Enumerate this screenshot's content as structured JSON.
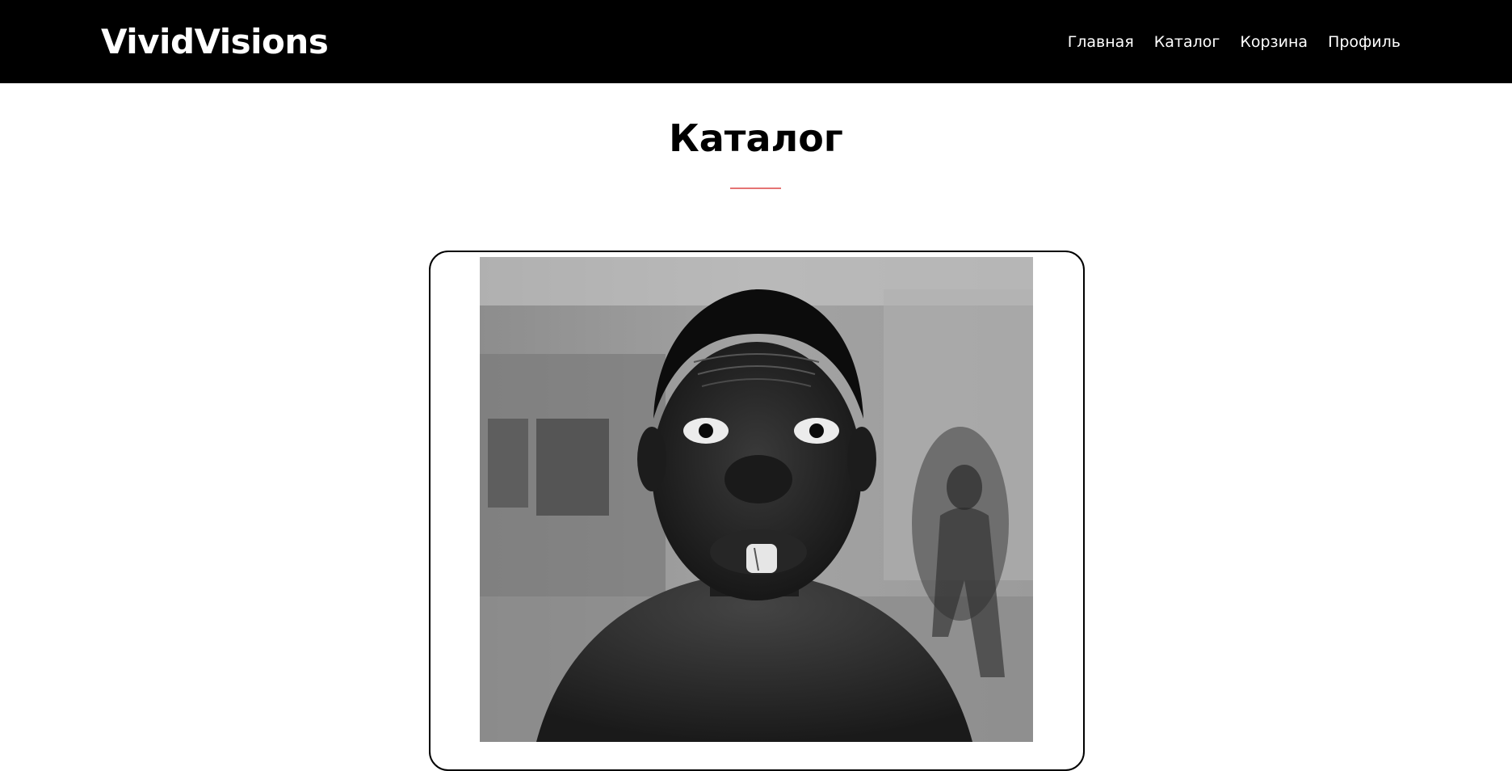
{
  "header": {
    "logo": "VividVisions",
    "nav": [
      {
        "label": "Главная"
      },
      {
        "label": "Каталог"
      },
      {
        "label": "Корзина"
      },
      {
        "label": "Профиль"
      }
    ]
  },
  "main": {
    "title": "Каталог",
    "accent_color": "#e57373",
    "products": [
      {
        "image": "black-and-white-portrait-photo"
      }
    ]
  }
}
